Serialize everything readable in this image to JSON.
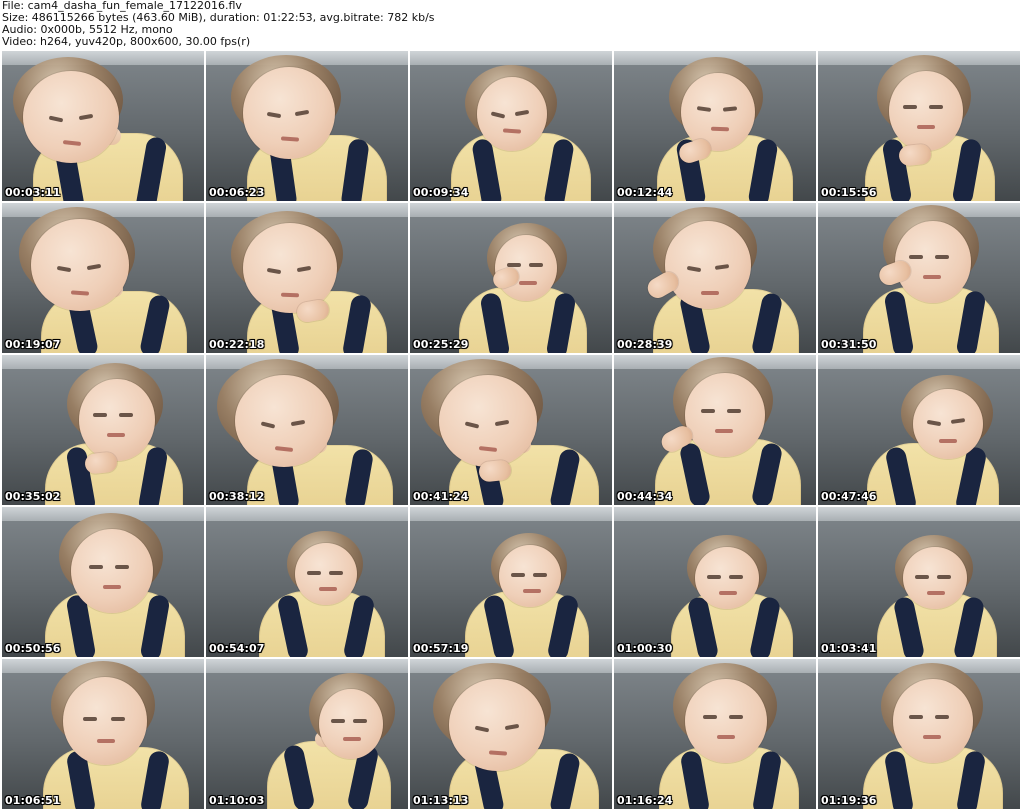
{
  "header": {
    "file": "File: cam4_dasha_fun_female_17122016.flv",
    "size": "Size: 486115266 bytes (463.60 MiB), duration: 01:22:53, avg.bitrate: 782 kb/s",
    "audio": "Audio: 0x000b, 5512 Hz, mono",
    "video": "Video: h264, yuv420p, 800x600, 30.00 fps(r)"
  },
  "thumbnails": [
    {
      "timestamp": "00:03:11"
    },
    {
      "timestamp": "00:06:23"
    },
    {
      "timestamp": "00:09:34"
    },
    {
      "timestamp": "00:12:44"
    },
    {
      "timestamp": "00:15:56"
    },
    {
      "timestamp": "00:19:07"
    },
    {
      "timestamp": "00:22:18"
    },
    {
      "timestamp": "00:25:29"
    },
    {
      "timestamp": "00:28:39"
    },
    {
      "timestamp": "00:31:50"
    },
    {
      "timestamp": "00:35:02"
    },
    {
      "timestamp": "00:38:12"
    },
    {
      "timestamp": "00:41:24"
    },
    {
      "timestamp": "00:44:34"
    },
    {
      "timestamp": "00:47:46"
    },
    {
      "timestamp": "00:50:56"
    },
    {
      "timestamp": "00:54:07"
    },
    {
      "timestamp": "00:57:19"
    },
    {
      "timestamp": "01:00:30"
    },
    {
      "timestamp": "01:03:41"
    },
    {
      "timestamp": "01:06:51"
    },
    {
      "timestamp": "01:10:03"
    },
    {
      "timestamp": "01:13:13"
    },
    {
      "timestamp": "01:16:24"
    },
    {
      "timestamp": "01:19:36"
    }
  ]
}
